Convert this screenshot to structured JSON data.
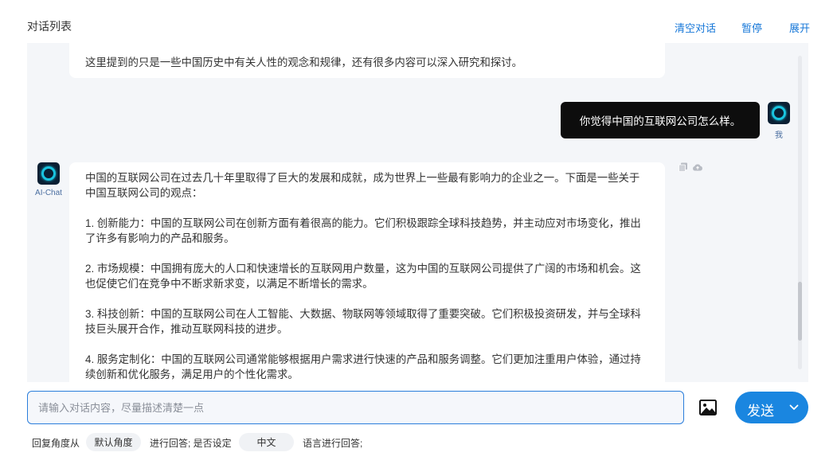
{
  "header": {
    "title": "对话列表",
    "actions": {
      "clear": "清空对话",
      "pause": "暂停",
      "expand": "展开"
    }
  },
  "chat": {
    "previous_message_tail": "这里提到的只是一些中国历史中有关人性的观念和规律，还有很多内容可以深入研究和探讨。",
    "user_message": {
      "text": "你觉得中国的互联网公司怎么样。",
      "avatar_label": "我"
    },
    "ai_message": {
      "avatar_label": "AI-Chat",
      "paragraphs": [
        "中国的互联网公司在过去几十年里取得了巨大的发展和成就，成为世界上一些最有影响力的企业之一。下面是一些关于中国互联网公司的观点：",
        "1. 创新能力：中国的互联网公司在创新方面有着很高的能力。它们积极跟踪全球科技趋势，并主动应对市场变化，推出了许多有影响力的产品和服务。",
        "2. 市场规模：中国拥有庞大的人口和快速增长的互联网用户数量，这为中国的互联网公司提供了广阔的市场和机会。这也促使它们在竞争中不断求新求变，以满足不断增长的需求。",
        "3. 科技创新：中国的互联网公司在人工智能、大数据、物联网等领域取得了重要突破。它们积极投资研发，并与全球科技巨头展开合作，推动互联网科技的进步。",
        "4. 服务定制化：中国的互联网公司通常能够根据用户需求进行快速的产品和服务调整。它们更加注重用户体验，通过持续创新和优化服务，满足用户的个性化需求。"
      ]
    },
    "icons": {
      "copy": "copy-icon",
      "cloud": "cloud-upload-icon",
      "avatar": "ai-ring-logo-icon"
    }
  },
  "composer": {
    "placeholder": "请输入对话内容，尽量描述清楚一点",
    "value": "",
    "send_label": "发送"
  },
  "options": {
    "angle_prefix": "回复角度从",
    "angle_value": "默认角度",
    "mid_text": "进行回答; 是否设定",
    "language_value": "中文",
    "suffix_text": "语言进行回答;"
  },
  "colors": {
    "accent": "#1a86e0",
    "link": "#1677d8",
    "user_bubble": "#0d0d0d",
    "panel_bg": "#f4f6f9"
  }
}
